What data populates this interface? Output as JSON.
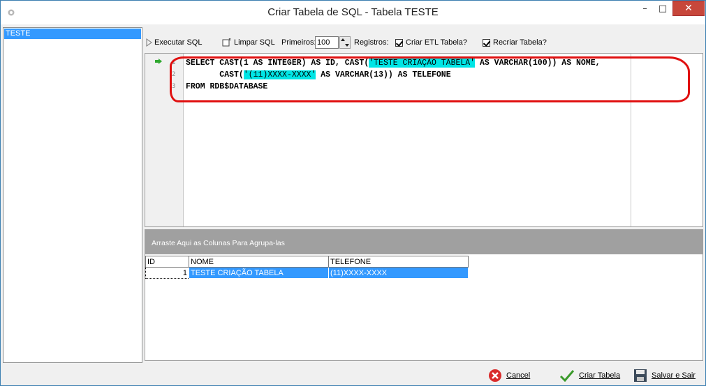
{
  "window": {
    "title": "Criar Tabela de SQL - Tabela TESTE",
    "minimize": "–",
    "maximize": "□",
    "close": "✕"
  },
  "sidebar": {
    "items": [
      {
        "label": "TESTE"
      }
    ]
  },
  "toolbar": {
    "execute_label": "Executar SQL",
    "clear_label": "Limpar SQL",
    "first_label": "Primeiros:",
    "first_value": "100",
    "records_label": "Registros:",
    "create_etl_label": "Criar ETL Tabela?",
    "recreate_label": "Recriar Tabela?"
  },
  "editor": {
    "line1_a": "SELECT CAST(1 AS INTEGER) AS ID, CAST(",
    "line1_str": "'TESTE CRIAÇÃO TABELA'",
    "line1_b": " AS VARCHAR(100)) AS NOME,",
    "line2_a": "       CAST(",
    "line2_str": "'(11)XXXX-XXXX'",
    "line2_b": " AS VARCHAR(13)) AS TELEFONE",
    "line3": "FROM RDB$DATABASE"
  },
  "grid": {
    "group_hint": "Arraste Aqui as Colunas Para Agrupa-las",
    "columns": [
      "ID",
      "NOME",
      "TELEFONE"
    ],
    "rows": [
      {
        "id": "1",
        "nome": "TESTE CRIAÇÃO TABELA",
        "telefone": "(11)XXXX-XXXX"
      }
    ]
  },
  "footer": {
    "cancel_label": "Cancel",
    "create_label": "Criar Tabela",
    "save_exit_label": "Salvar e Sair"
  },
  "colors": {
    "selection": "#3399ff",
    "string_highlight": "#00e5e5",
    "annotation": "#e01010",
    "close_button": "#c7473b"
  }
}
